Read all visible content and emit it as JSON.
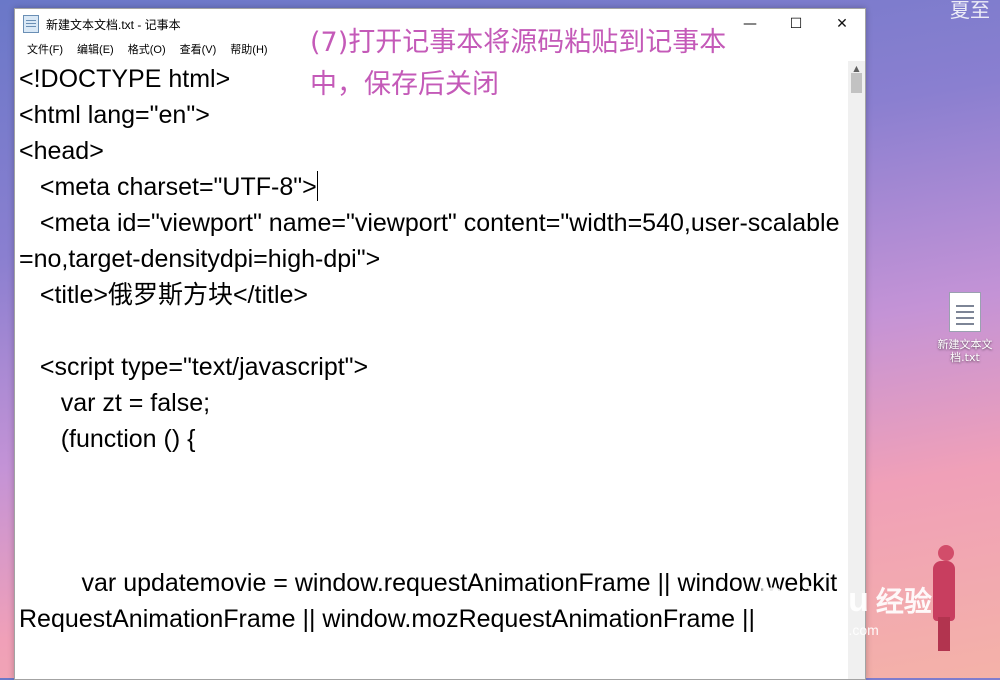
{
  "window": {
    "title": "新建文本文档.txt - 记事本",
    "controls": {
      "minimize": "—",
      "maximize": "☐",
      "close": "✕"
    }
  },
  "menu": [
    {
      "label": "文件(F)"
    },
    {
      "label": "编辑(E)"
    },
    {
      "label": "格式(O)"
    },
    {
      "label": "查看(V)"
    },
    {
      "label": "帮助(H)"
    }
  ],
  "editor": {
    "before_caret": "<!DOCTYPE html>\n<html lang=\"en\">\n<head>\n   <meta charset=\"UTF-8\">",
    "after_caret": "\n   <meta id=\"viewport\" name=\"viewport\" content=\"width=540,user-scalable=no,target-densitydpi=high-dpi\">\n   <title>俄罗斯方块</title>\n\n   <script type=\"text/javascript\">\n      var zt = false;\n      (function () {\n\n\n\n         var updatemovie = window.requestAnimationFrame || window.webkitRequestAnimationFrame || window.mozRequestAnimationFrame ||"
  },
  "overlay": {
    "instruction": "(7)打开记事本将源码粘贴到记事本中，保存后关闭"
  },
  "desktop": {
    "top_right_text": "夏至",
    "file_icon_label": "新建文本文档.txt"
  },
  "watermark": {
    "logo": "Bai du",
    "jingyan": "经验",
    "url": "jingyan.baidu.com"
  },
  "icons": {
    "app": "notepad-icon",
    "desktop_file": "text-file-icon"
  }
}
